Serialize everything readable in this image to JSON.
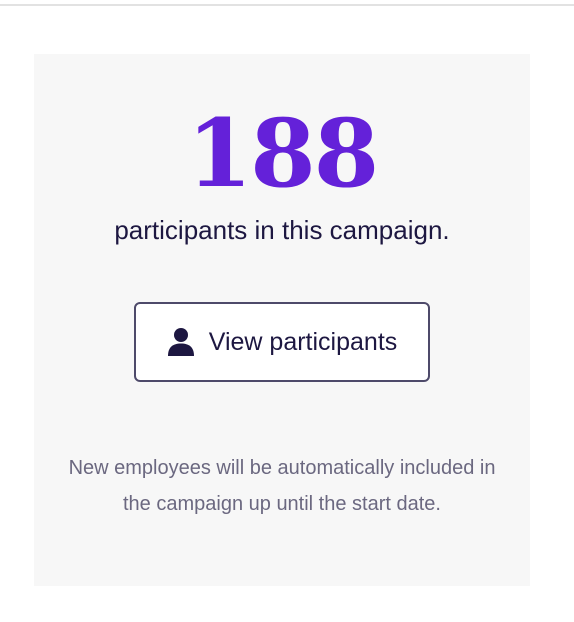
{
  "campaign": {
    "participant_count": "188",
    "participant_caption": "participants in this campaign.",
    "view_button_label": "View participants",
    "view_button_icon": "person-icon",
    "note": "New employees will be automatically included in the campaign up until the start date."
  },
  "colors": {
    "accent": "#6421d9",
    "text_primary": "#1d1741",
    "text_muted": "#6b6880",
    "card_background": "#f7f7f7",
    "button_border": "#4e4a6a"
  }
}
